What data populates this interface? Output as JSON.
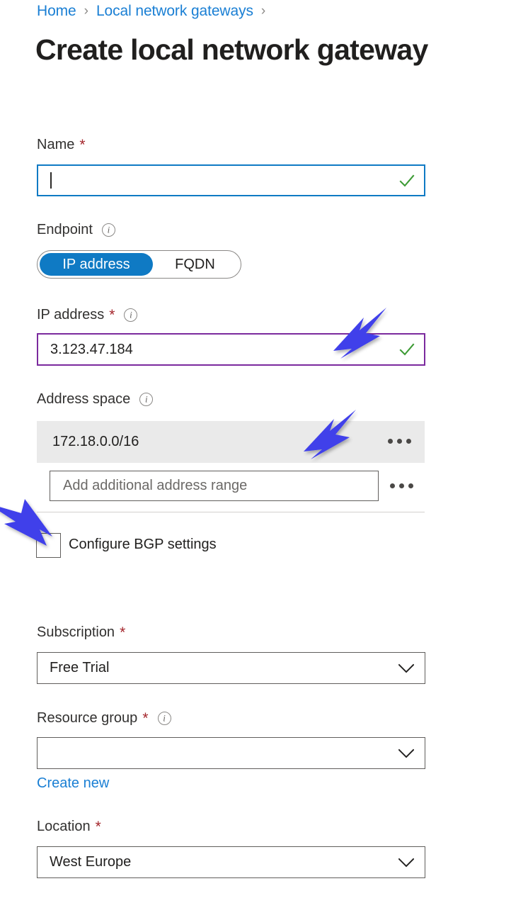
{
  "breadcrumb": {
    "items": [
      {
        "label": "Home",
        "type": "link"
      },
      {
        "label": "Local network gateways",
        "type": "link"
      }
    ],
    "separator": "›"
  },
  "page": {
    "title": "Create local network gateway"
  },
  "form": {
    "name": {
      "label": "Name",
      "required_marker": "*",
      "value": "",
      "state": "focused",
      "validation": "valid"
    },
    "endpoint": {
      "label": "Endpoint",
      "info_icon": "info-icon",
      "options": [
        {
          "label": "IP address",
          "selected": true
        },
        {
          "label": "FQDN",
          "selected": false
        }
      ]
    },
    "ip_address": {
      "label": "IP address",
      "required_marker": "*",
      "info_icon": "info-icon",
      "value": "3.123.47.184",
      "state": "highlighted",
      "validation": "valid"
    },
    "address_space": {
      "label": "Address space",
      "info_icon": "info-icon",
      "ranges": [
        {
          "value": "172.18.0.0/16",
          "menu": "ellipsis-menu"
        }
      ],
      "add_row": {
        "placeholder": "Add additional address range",
        "value": "",
        "menu": "ellipsis-menu"
      }
    },
    "bgp": {
      "label": "Configure BGP settings",
      "checked": false
    },
    "subscription": {
      "label": "Subscription",
      "required_marker": "*",
      "value": "Free Trial"
    },
    "resource_group": {
      "label": "Resource group",
      "required_marker": "*",
      "info_icon": "info-icon",
      "value": "",
      "create_new_link": "Create new"
    },
    "location": {
      "label": "Location",
      "required_marker": "*",
      "value": "West Europe"
    }
  },
  "annotations": {
    "arrow_color": "#3f3fea",
    "arrows": [
      {
        "name": "arrow-ip-address",
        "target": "ip-address-input"
      },
      {
        "name": "arrow-address-space",
        "target": "address-space-row"
      },
      {
        "name": "arrow-bgp-checkbox",
        "target": "configure-bgp-checkbox"
      }
    ]
  },
  "colors": {
    "link": "#1a7fd4",
    "accent": "#0f7ac4",
    "required": "#a4262c",
    "valid": "#3d9b35",
    "highlight_border": "#7b2a9e",
    "row_background": "#eaeaea"
  }
}
